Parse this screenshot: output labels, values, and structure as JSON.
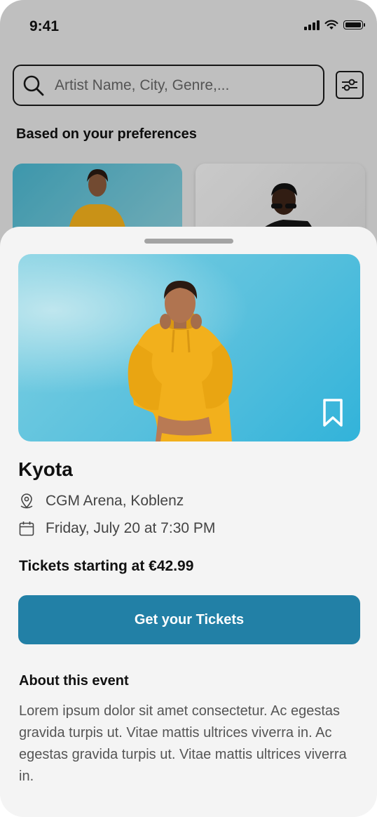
{
  "status_bar": {
    "time": "9:41"
  },
  "search": {
    "placeholder": "Artist Name, City, Genre,..."
  },
  "section": {
    "title": "Based on your preferences"
  },
  "event": {
    "title": "Kyota",
    "venue": "CGM Arena, Koblenz",
    "datetime": "Friday, July 20 at 7:30 PM",
    "price_text": "Tickets starting at €42.99",
    "cta_label": "Get your Tickets",
    "about_title": "About this event",
    "about_body": "Lorem ipsum dolor sit amet consectetur. Ac egestas gravida turpis ut. Vitae mattis ultrices viverra in. Ac egestas gravida turpis ut. Vitae mattis ultrices viverra in."
  },
  "icons": {
    "search": "search-icon",
    "filter": "sliders-icon",
    "bookmark": "bookmark-icon",
    "location": "map-pin-icon",
    "calendar": "calendar-icon"
  },
  "colors": {
    "accent": "#2280a6",
    "hoodie": "#f2b01c",
    "sky": "#4fc0dd"
  }
}
